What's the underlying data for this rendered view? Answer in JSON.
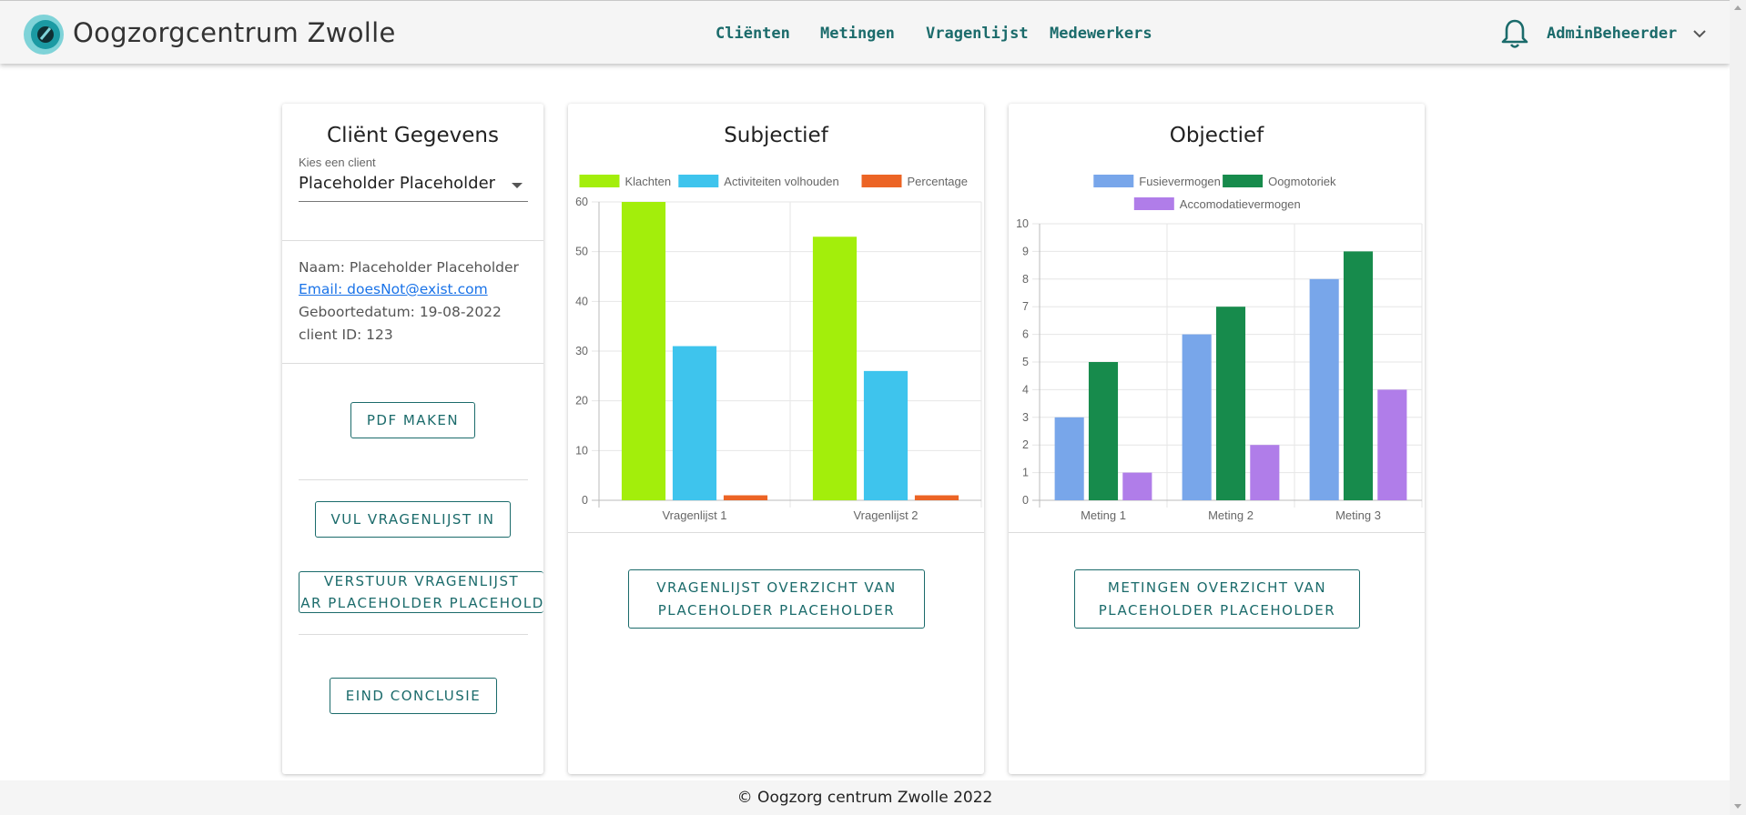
{
  "header": {
    "brand": "Oogzorgcentrum Zwolle",
    "nav": [
      "Cliënten",
      "Metingen",
      "Vragenlijst",
      "Medewerkers"
    ],
    "user": "AdminBeheerder"
  },
  "client_card": {
    "title": "Cliënt Gegevens",
    "select_label": "Kies een client",
    "select_value": "Placeholder Placeholder",
    "name": "Naam: Placeholder Placeholder",
    "email": "Email: doesNot@exist.com",
    "birthdate": "Geboortedatum: 19-08-2022",
    "client_id": "client ID: 123",
    "pdf_button": "PDF MAKEN",
    "fill_button": "VUL VRAGENLIJST IN",
    "send_button_line1": "VERSTUUR VRAGENLIJST",
    "send_button_line2": "NAAR PLACEHOLDER PLACEHOLDER",
    "conclusion_button": "EIND CONCLUSIE"
  },
  "subjective_card": {
    "title": "Subjectief",
    "button_line1": "VRAGENLIJST OVERZICHT VAN",
    "button_line2": "PLACEHOLDER PLACEHOLDER"
  },
  "objective_card": {
    "title": "Objectief",
    "button_line1": "METINGEN OVERZICHT VAN",
    "button_line2": "PLACEHOLDER PLACEHOLDER"
  },
  "footer": "© Oogzorg centrum Zwolle 2022",
  "chart_data": [
    {
      "type": "bar",
      "categories": [
        "Vragenlijst 1",
        "Vragenlijst 2"
      ],
      "series": [
        {
          "name": "Klachten",
          "values": [
            60,
            53
          ],
          "color": "#a3ee0b"
        },
        {
          "name": "Activiteiten volhouden",
          "values": [
            31,
            26
          ],
          "color": "#3ec4ed"
        },
        {
          "name": "Percentage",
          "values": [
            1,
            1
          ],
          "color": "#ec6425"
        }
      ],
      "ylim": [
        0,
        60
      ],
      "yticks": [
        0,
        10,
        20,
        30,
        40,
        50,
        60
      ],
      "grid": true,
      "legend": "top"
    },
    {
      "type": "bar",
      "categories": [
        "Meting 1",
        "Meting 2",
        "Meting 3"
      ],
      "series": [
        {
          "name": "Fusievermogen",
          "values": [
            3,
            6,
            8
          ],
          "color": "#78a6ea"
        },
        {
          "name": "Oogmotoriek",
          "values": [
            5,
            7,
            9
          ],
          "color": "#178b4c"
        },
        {
          "name": "Accomodatievermogen",
          "values": [
            1,
            2,
            4
          ],
          "color": "#b07de9"
        }
      ],
      "ylim": [
        0,
        10
      ],
      "yticks": [
        0,
        1,
        2,
        3,
        4,
        5,
        6,
        7,
        8,
        9,
        10
      ],
      "grid": true,
      "legend": "top"
    }
  ]
}
